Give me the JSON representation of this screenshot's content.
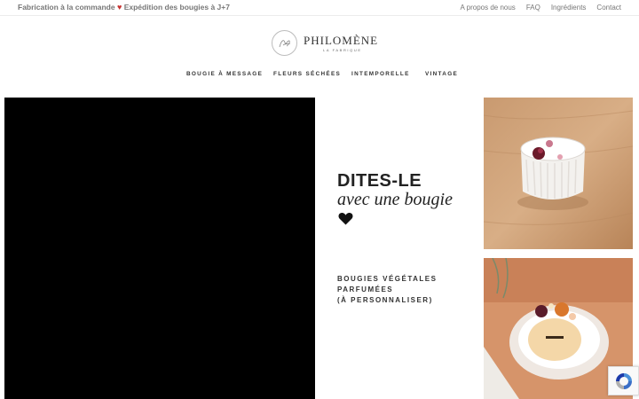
{
  "topbar": {
    "promo_left": "Fabrication à la commande",
    "promo_right": "Expédition des bougies à J+7",
    "heart_icon": "heart-icon",
    "links": [
      "A propos de nous",
      "FAQ",
      "Ingrédients",
      "Contact"
    ]
  },
  "logo": {
    "name": "PHILOMÈNE",
    "sub": "LA FABRIQUE"
  },
  "nav": {
    "items": [
      "BOUGIE À MESSAGE",
      "FLEURS SÉCHÉES",
      "INTEMPORELLE",
      "VINTAGE"
    ]
  },
  "hero": {
    "headline": "DITES-LE",
    "script": "avec une bougie",
    "subtitle": [
      "BOUGIES VÉGÉTALES",
      "PARFUMÉES",
      "(À PERSONNALISER)"
    ]
  },
  "colors": {
    "accent_heart": "#c7312f",
    "text": "#222222",
    "muted": "#777777"
  },
  "icons": {
    "logo": "signature-logo-icon",
    "big_heart": "heart-icon",
    "recaptcha": "recaptcha-icon"
  }
}
